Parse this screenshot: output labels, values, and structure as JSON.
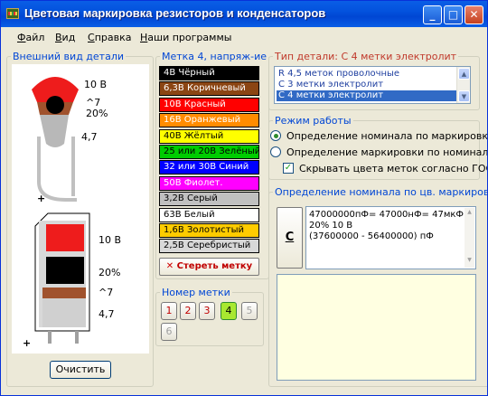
{
  "window": {
    "title": "Цветовая маркировка резисторов и конденсаторов",
    "minimize_glyph": "_",
    "maximize_glyph": "□",
    "close_glyph": "✕"
  },
  "menu": {
    "file": "Файл",
    "view": "Вид",
    "help": "Справка",
    "programs": "Наши программы"
  },
  "appearance": {
    "legend": "Внешний вид детали",
    "top_capacitor": {
      "label_voltage": "10 В",
      "label_tc": "^7",
      "label_tol": "20%",
      "label_value": "4,7",
      "plus": "+"
    },
    "bottom_capacitor": {
      "label_voltage": "10 В",
      "label_tol": "20%",
      "label_tc": "^7",
      "label_value": "4,7",
      "plus": "+"
    },
    "clear_button": "Очистить"
  },
  "colors": {
    "legend": "Метка 4, напряж-ие",
    "items": [
      {
        "label": "4В Чёрный",
        "bg": "#000000",
        "fg": "#ffffff"
      },
      {
        "label": "6,3В Коричневый",
        "bg": "#8b4513",
        "fg": "#ffffff"
      },
      {
        "label": "10В Красный",
        "bg": "#ff0000",
        "fg": "#ffffff"
      },
      {
        "label": "16В Оранжевый",
        "bg": "#ff8c00",
        "fg": "#ffffff"
      },
      {
        "label": "40В Жёлтый",
        "bg": "#ffff00",
        "fg": "#000000"
      },
      {
        "label": "25 или 20В Зелёный",
        "bg": "#00cc00",
        "fg": "#000000"
      },
      {
        "label": "32 или 30В Синий",
        "bg": "#0000ff",
        "fg": "#ffffff"
      },
      {
        "label": "50В Фиолет.",
        "bg": "#ff00ff",
        "fg": "#ffffff"
      },
      {
        "label": "3,2В Серый",
        "bg": "#c0c0c0",
        "fg": "#000000"
      },
      {
        "label": "63В Белый",
        "bg": "#ffffff",
        "fg": "#000000"
      },
      {
        "label": "1,6В Золотистый",
        "bg": "#ffcc00",
        "fg": "#000000"
      },
      {
        "label": "2,5В Серебристый",
        "bg": "#d8d8d8",
        "fg": "#000000"
      }
    ],
    "clear_mark_icon": "✕",
    "clear_mark_label": "Стереть метку"
  },
  "mark_number": {
    "legend": "Номер метки",
    "buttons": [
      "1",
      "2",
      "3",
      "4",
      "5",
      "6"
    ],
    "active": "4"
  },
  "part_type": {
    "legend": "Тип детали: С 4 метки электролит",
    "options": [
      "R 4,5 меток проволочные",
      "С 3 метки электролит",
      "С 4 метки электролит"
    ],
    "selected": "С 4 метки электролит"
  },
  "mode": {
    "legend": "Режим работы",
    "option1": "Определение номинала по маркировке",
    "option2": "Определение маркировки по номиналу",
    "checkbox": "Скрывать цвета меток согласно ГОСТ"
  },
  "result": {
    "legend": "Определение номинала по цв. маркировке",
    "copy_button": "С",
    "line1": "47000000пФ= 47000нФ= 47мкФ",
    "line2": "20%  10 В",
    "line3": "(37600000 - 56400000) пФ"
  }
}
